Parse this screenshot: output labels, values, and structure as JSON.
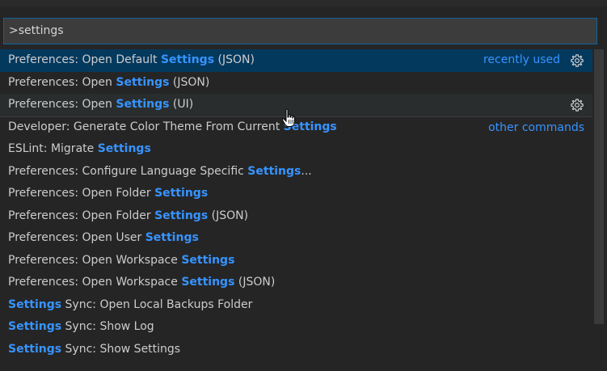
{
  "palette": {
    "input_value": ">settings",
    "items": [
      {
        "pre": "Preferences: Open Default ",
        "hl": "Settings",
        "post": " (JSON)",
        "tag": "recently used",
        "gear": true,
        "state": "selected",
        "sep": false
      },
      {
        "pre": "Preferences: Open ",
        "hl": "Settings",
        "post": " (JSON)",
        "tag": "",
        "gear": false,
        "state": "",
        "sep": false
      },
      {
        "pre": "Preferences: Open ",
        "hl": "Settings",
        "post": " (UI)",
        "tag": "",
        "gear": true,
        "state": "hover",
        "sep": false
      },
      {
        "pre": "Developer: Generate Color Theme From Current ",
        "hl": "Settings",
        "post": "",
        "tag": "other commands",
        "gear": false,
        "state": "",
        "sep": true
      },
      {
        "pre": "ESLint: Migrate ",
        "hl": "Settings",
        "post": "",
        "tag": "",
        "gear": false,
        "state": "",
        "sep": false
      },
      {
        "pre": "Preferences: Configure Language Specific ",
        "hl": "Settings",
        "post": "...",
        "tag": "",
        "gear": false,
        "state": "",
        "sep": false
      },
      {
        "pre": "Preferences: Open Folder ",
        "hl": "Settings",
        "post": "",
        "tag": "",
        "gear": false,
        "state": "",
        "sep": false
      },
      {
        "pre": "Preferences: Open Folder ",
        "hl": "Settings",
        "post": " (JSON)",
        "tag": "",
        "gear": false,
        "state": "",
        "sep": false
      },
      {
        "pre": "Preferences: Open User ",
        "hl": "Settings",
        "post": "",
        "tag": "",
        "gear": false,
        "state": "",
        "sep": false
      },
      {
        "pre": "Preferences: Open Workspace ",
        "hl": "Settings",
        "post": "",
        "tag": "",
        "gear": false,
        "state": "",
        "sep": false
      },
      {
        "pre": "Preferences: Open Workspace ",
        "hl": "Settings",
        "post": " (JSON)",
        "tag": "",
        "gear": false,
        "state": "",
        "sep": false
      },
      {
        "pre": "",
        "hl": "Settings",
        "post": " Sync: Open Local Backups Folder",
        "tag": "",
        "gear": false,
        "state": "",
        "sep": false
      },
      {
        "pre": "",
        "hl": "Settings",
        "post": " Sync: Show Log",
        "tag": "",
        "gear": false,
        "state": "",
        "sep": false
      },
      {
        "pre": "",
        "hl": "Settings",
        "post": " Sync: Show Settings",
        "tag": "",
        "gear": false,
        "state": "",
        "sep": false
      }
    ]
  },
  "icons": {
    "gear": "gear-icon",
    "cursor": "hand-pointer-icon"
  },
  "colors": {
    "highlight": "#3794ff",
    "selected_bg": "#04395e",
    "input_border": "#0e639c"
  }
}
